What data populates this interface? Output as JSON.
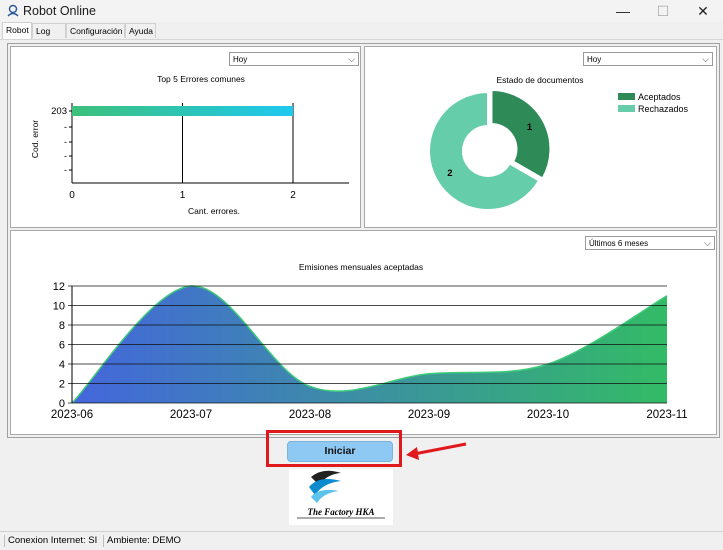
{
  "window": {
    "title": "Robot Online",
    "minimize_glyph": "—",
    "maximize_glyph": "☐",
    "close_glyph": "✕"
  },
  "tabs": [
    {
      "label": "Robot",
      "active": true
    },
    {
      "label": "Log",
      "active": false
    },
    {
      "label": "Configuración",
      "active": false
    },
    {
      "label": "Ayuda",
      "active": false
    }
  ],
  "panels": {
    "errors": {
      "filter": "Hoy",
      "title": "Top 5 Errores comunes",
      "ylabel": "Cod. error",
      "xlabel": "Cant. errores."
    },
    "documents": {
      "filter": "Hoy",
      "title": "Estado de documentos"
    },
    "emissions": {
      "filter": "Últimos 6 meses",
      "title": "Emisiones mensuales aceptadas"
    }
  },
  "chart_data": [
    {
      "type": "bar",
      "title": "Top 5 Errores comunes",
      "xlabel": "Cant. errores.",
      "ylabel": "Cod. error",
      "categories": [
        "203",
        "-",
        "-",
        "-",
        "-"
      ],
      "values": [
        2,
        0,
        0,
        0,
        0
      ],
      "xlim": [
        0,
        2
      ],
      "x_ticks": [
        "0",
        "1",
        "2"
      ],
      "colors": [
        "#3cc07a",
        "#1ec8f0"
      ]
    },
    {
      "type": "pie",
      "title": "Estado de documentos",
      "labels": [
        "Aceptados",
        "Rechazados"
      ],
      "values": [
        1,
        2
      ],
      "colors": [
        "#2e8b57",
        "#66cdaa"
      ],
      "legend": "top-right"
    },
    {
      "type": "area",
      "title": "Emisiones mensuales aceptadas",
      "x": [
        "2023-06",
        "2023-07",
        "2023-08",
        "2023-09",
        "2023-10",
        "2023-11"
      ],
      "values": [
        0,
        12,
        1.7,
        3,
        4,
        11
      ],
      "ylim": [
        0,
        12
      ],
      "y_ticks": [
        "0",
        "2",
        "4",
        "6",
        "8",
        "10",
        "12"
      ],
      "colors": [
        "#4466dd",
        "#33bb66"
      ]
    }
  ],
  "button": {
    "label": "Iniciar"
  },
  "logo": {
    "text": "The Factory HKA"
  },
  "status": {
    "internet": "Conexion Internet: SI",
    "environment": "Ambiente: DEMO"
  },
  "annotation_color": "#e0191c"
}
